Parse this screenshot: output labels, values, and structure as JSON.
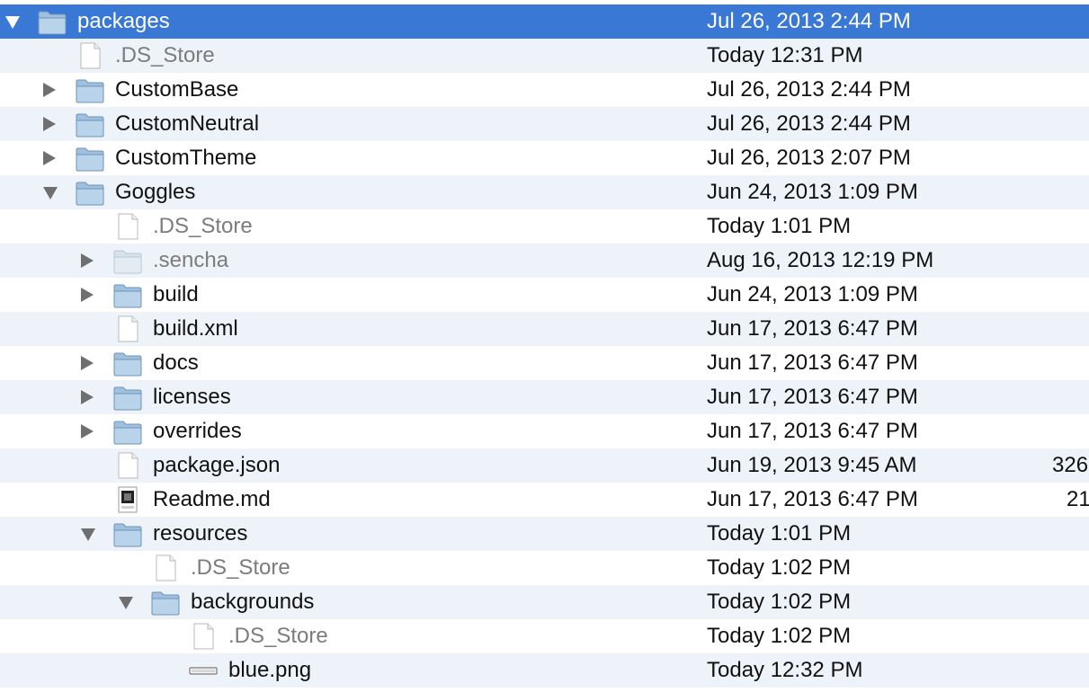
{
  "rows": [
    {
      "name": "packages",
      "date": "Jul 26, 2013 2:44 PM",
      "size": "",
      "type": "folder",
      "depth": 0,
      "disclosure": "down",
      "dim": false,
      "selected": true
    },
    {
      "name": ".DS_Store",
      "date": "Today 12:31 PM",
      "size": "",
      "type": "file",
      "depth": 1,
      "disclosure": "none",
      "dim": true,
      "selected": false
    },
    {
      "name": "CustomBase",
      "date": "Jul 26, 2013 2:44 PM",
      "size": "",
      "type": "folder",
      "depth": 1,
      "disclosure": "right",
      "dim": false,
      "selected": false
    },
    {
      "name": "CustomNeutral",
      "date": "Jul 26, 2013 2:44 PM",
      "size": "",
      "type": "folder",
      "depth": 1,
      "disclosure": "right",
      "dim": false,
      "selected": false
    },
    {
      "name": "CustomTheme",
      "date": "Jul 26, 2013 2:07 PM",
      "size": "",
      "type": "folder",
      "depth": 1,
      "disclosure": "right",
      "dim": false,
      "selected": false
    },
    {
      "name": "Goggles",
      "date": "Jun 24, 2013 1:09 PM",
      "size": "",
      "type": "folder",
      "depth": 1,
      "disclosure": "down",
      "dim": false,
      "selected": false
    },
    {
      "name": ".DS_Store",
      "date": "Today 1:01 PM",
      "size": "",
      "type": "file",
      "depth": 2,
      "disclosure": "none",
      "dim": true,
      "selected": false
    },
    {
      "name": ".sencha",
      "date": "Aug 16, 2013 12:19 PM",
      "size": "",
      "type": "folder",
      "depth": 2,
      "disclosure": "right",
      "dim": true,
      "selected": false
    },
    {
      "name": "build",
      "date": "Jun 24, 2013 1:09 PM",
      "size": "",
      "type": "folder",
      "depth": 2,
      "disclosure": "right",
      "dim": false,
      "selected": false
    },
    {
      "name": "build.xml",
      "date": "Jun 17, 2013 6:47 PM",
      "size": "",
      "type": "file",
      "depth": 2,
      "disclosure": "none",
      "dim": false,
      "selected": false
    },
    {
      "name": "docs",
      "date": "Jun 17, 2013 6:47 PM",
      "size": "",
      "type": "folder",
      "depth": 2,
      "disclosure": "right",
      "dim": false,
      "selected": false
    },
    {
      "name": "licenses",
      "date": "Jun 17, 2013 6:47 PM",
      "size": "",
      "type": "folder",
      "depth": 2,
      "disclosure": "right",
      "dim": false,
      "selected": false
    },
    {
      "name": "overrides",
      "date": "Jun 17, 2013 6:47 PM",
      "size": "",
      "type": "folder",
      "depth": 2,
      "disclosure": "right",
      "dim": false,
      "selected": false
    },
    {
      "name": "package.json",
      "date": "Jun 19, 2013 9:45 AM",
      "size": "326",
      "type": "file",
      "depth": 2,
      "disclosure": "none",
      "dim": false,
      "selected": false
    },
    {
      "name": "Readme.md",
      "date": "Jun 17, 2013 6:47 PM",
      "size": "21",
      "type": "markdown",
      "depth": 2,
      "disclosure": "none",
      "dim": false,
      "selected": false
    },
    {
      "name": "resources",
      "date": "Today 1:01 PM",
      "size": "",
      "type": "folder",
      "depth": 2,
      "disclosure": "down",
      "dim": false,
      "selected": false
    },
    {
      "name": ".DS_Store",
      "date": "Today 1:02 PM",
      "size": "",
      "type": "file",
      "depth": 3,
      "disclosure": "none",
      "dim": true,
      "selected": false
    },
    {
      "name": "backgrounds",
      "date": "Today 1:02 PM",
      "size": "",
      "type": "folder",
      "depth": 3,
      "disclosure": "down",
      "dim": false,
      "selected": false
    },
    {
      "name": ".DS_Store",
      "date": "Today 1:02 PM",
      "size": "",
      "type": "file",
      "depth": 4,
      "disclosure": "none",
      "dim": true,
      "selected": false
    },
    {
      "name": "blue.png",
      "date": "Today 12:32 PM",
      "size": "",
      "type": "image",
      "depth": 4,
      "disclosure": "none",
      "dim": false,
      "selected": false
    }
  ]
}
